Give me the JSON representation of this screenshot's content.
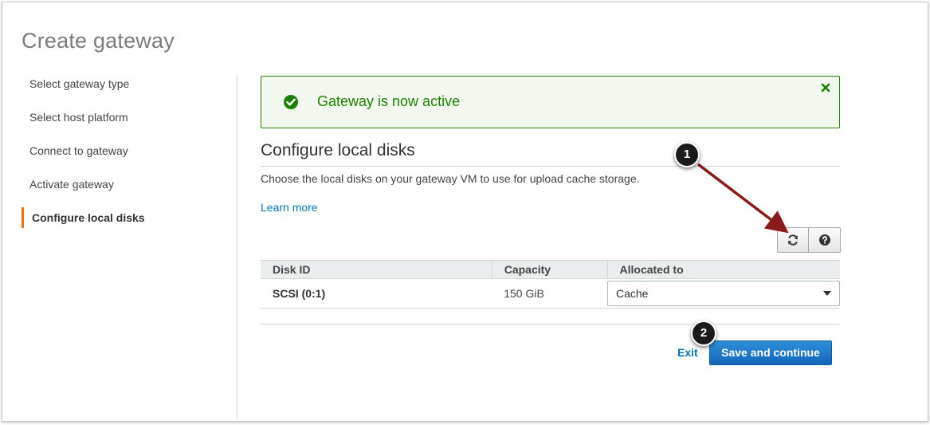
{
  "page": {
    "title": "Create gateway"
  },
  "sidebar": {
    "steps": [
      {
        "label": "Select gateway type"
      },
      {
        "label": "Select host platform"
      },
      {
        "label": "Connect to gateway"
      },
      {
        "label": "Activate gateway"
      },
      {
        "label": "Configure local disks",
        "active": true
      }
    ]
  },
  "alert": {
    "message": "Gateway is now active",
    "type": "success",
    "icon": "check-circle-icon",
    "close_icon": "close-icon",
    "color": "#1d8102"
  },
  "section": {
    "title": "Configure local disks",
    "description": "Choose the local disks on your gateway VM to use for upload cache storage.",
    "learn_more": "Learn more"
  },
  "toolbar": {
    "refresh_icon": "refresh-icon",
    "help_icon": "help-icon"
  },
  "table": {
    "columns": [
      "Disk ID",
      "Capacity",
      "Allocated to"
    ],
    "rows": [
      {
        "disk_id": "SCSI (0:1)",
        "capacity": "150 GiB",
        "allocated_to": "Cache"
      }
    ]
  },
  "footer": {
    "exit_label": "Exit",
    "save_label": "Save and continue"
  },
  "annotations": {
    "callout_1": "1",
    "callout_2": "2"
  },
  "colors": {
    "accent_orange": "#ec7211",
    "link_blue": "#0073bb",
    "primary_blue": "#1166bb",
    "annotation_arrow": "#8b1a1a"
  }
}
